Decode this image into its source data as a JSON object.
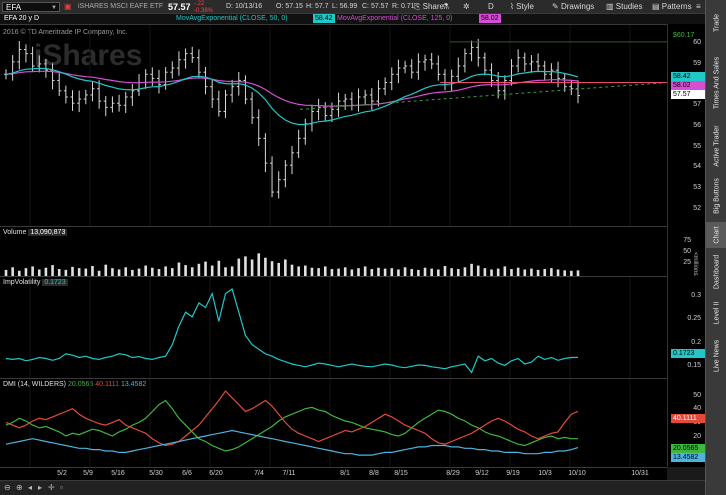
{
  "toolbar": {
    "symbol": "EFA",
    "company": "iSHARES MSCI EAFE ETF",
    "last": "57.57",
    "change": "-.22",
    "change_pct": "-0.38%",
    "d_label": "D: 10/13/16",
    "o_label": "O: 57.15",
    "h_label": "H: 57.7",
    "l_label": "L: 56.99",
    "c_label": "C: 57.57",
    "r_label": "R: 0.71",
    "share": "Share",
    "aggregation": "D",
    "style": "Style",
    "drawings": "Drawings",
    "studies": "Studies",
    "patterns": "Patterns"
  },
  "header2": {
    "chart_label": "EFA 20 y D",
    "study1": "MovAvgExponential (CLOSE, 50, 0)",
    "study1_value": "58.42",
    "study2": "MovAvgExponential (CLOSE, 125, 0)",
    "study2_value": "58.02"
  },
  "price_pane": {
    "copyright": "2016 © TD Ameritrade IP Company, Inc.",
    "watermark": "iShares",
    "high_tag": "$60.17",
    "axis_labels": [
      "60",
      "59",
      "58",
      "57",
      "56",
      "55",
      "54",
      "53",
      "52"
    ],
    "tag_ema50": "58.42",
    "tag_ema125": "58.02",
    "tag_last": "57.57"
  },
  "volume_pane": {
    "title": "Volume",
    "value": "13,090,873",
    "axis_labels": [
      "75",
      "50",
      "25"
    ],
    "unit": "<millions>"
  },
  "iv_pane": {
    "title": "ImpVolatility",
    "value": "0.1723",
    "axis_labels": [
      "0.3",
      "0.25",
      "0.2",
      "0.15"
    ],
    "tag": "0.1723"
  },
  "dmi_pane": {
    "title": "DMI (14, WILDERS)",
    "v1": "20.0565",
    "v2": "40.1111",
    "v3": "13.4582",
    "axis_labels": [
      "50",
      "40",
      "30",
      "20",
      "10"
    ],
    "tag_red": "40.1111",
    "tag_green": "20.0565",
    "tag_blue": "13.4582"
  },
  "x_axis": [
    "5/2",
    "5/9",
    "5/16",
    "5/30",
    "6/6",
    "6/20",
    "7/4",
    "7/11",
    "8/1",
    "8/8",
    "8/15",
    "8/29",
    "9/12",
    "9/19",
    "10/3",
    "10/10",
    "10/31"
  ],
  "right_tabs": [
    "Trade",
    "Times And Sales",
    "Active Trader",
    "Big Buttons",
    "Chart",
    "Dashboard",
    "Level II",
    "Live News"
  ],
  "colors": {
    "up": "#ffffff",
    "down": "#ffffff",
    "ema50": "#22c7c7",
    "ema125": "#d44fd4",
    "trend": "#3d9b3d",
    "resistance": "#e84c6a",
    "iv": "#1fc7c7",
    "dmi_plus": "#3fb63f",
    "dmi_minus": "#e24b3b",
    "adx": "#4fb3e0",
    "negative": "#ff4040"
  },
  "chart_data": [
    {
      "type": "candlestick",
      "series": [
        {
          "name": "MovAvgExponential (CLOSE, 50, 0)",
          "last": 58.42
        },
        {
          "name": "MovAvgExponential (CLOSE, 125, 0)",
          "last": 58.02
        }
      ],
      "ylim": [
        51.5,
        60.5
      ],
      "closes": [
        58.6,
        59.2,
        59.8,
        59.6,
        59.0,
        59.1,
        58.8,
        58.3,
        57.8,
        57.5,
        57.2,
        57.4,
        57.6,
        57.9,
        57.3,
        57.0,
        57.2,
        57.1,
        57.5,
        57.8,
        58.2,
        58.6,
        58.4,
        58.1,
        58.7,
        58.9,
        59.3,
        59.6,
        59.4,
        58.7,
        58.0,
        57.4,
        56.8,
        57.6,
        58.0,
        58.3,
        57.4,
        56.5,
        55.5,
        54.3,
        52.9,
        53.5,
        54.2,
        54.8,
        55.5,
        56.2,
        56.8,
        57.0,
        56.6,
        56.9,
        57.3,
        57.4,
        57.1,
        57.5,
        57.6,
        57.3,
        57.9,
        58.2,
        58.6,
        58.9,
        59.0,
        58.7,
        59.2,
        59.3,
        59.1,
        58.6,
        58.2,
        58.5,
        59.0,
        59.6,
        59.9,
        59.4,
        58.8,
        58.3,
        57.8,
        58.3,
        59.0,
        59.4,
        59.1,
        59.2,
        59.0,
        58.6,
        58.8,
        58.4,
        58.0,
        57.9,
        57.57
      ],
      "last": 57.57,
      "high_marker": 60.17
    },
    {
      "type": "bar",
      "title": "Volume",
      "ylim": [
        0,
        85
      ],
      "values": [
        14,
        20,
        12,
        18,
        22,
        15,
        19,
        25,
        16,
        14,
        21,
        18,
        17,
        23,
        12,
        26,
        18,
        15,
        20,
        14,
        17,
        24,
        19,
        16,
        22,
        18,
        31,
        25,
        20,
        28,
        33,
        24,
        35,
        20,
        22,
        40,
        45,
        38,
        52,
        42,
        34,
        30,
        38,
        26,
        22,
        24,
        19,
        18,
        22,
        16,
        17,
        20,
        15,
        18,
        22,
        16,
        19,
        17,
        18,
        15,
        20,
        16,
        14,
        19,
        17,
        15,
        23,
        18,
        16,
        20,
        28,
        24,
        18,
        15,
        17,
        22,
        16,
        19,
        15,
        17,
        14,
        16,
        18,
        15,
        13,
        12,
        13
      ]
    },
    {
      "type": "line",
      "title": "ImpVolatility",
      "ylim": [
        0.13,
        0.32
      ],
      "values": [
        0.17,
        0.168,
        0.17,
        0.165,
        0.168,
        0.172,
        0.17,
        0.166,
        0.17,
        0.18,
        0.177,
        0.172,
        0.175,
        0.17,
        0.168,
        0.172,
        0.175,
        0.18,
        0.178,
        0.172,
        0.174,
        0.17,
        0.168,
        0.172,
        0.175,
        0.2,
        0.24,
        0.27,
        0.26,
        0.29,
        0.28,
        0.31,
        0.25,
        0.31,
        0.32,
        0.27,
        0.22,
        0.2,
        0.19,
        0.18,
        0.175,
        0.168,
        0.163,
        0.158,
        0.155,
        0.152,
        0.156,
        0.16,
        0.158,
        0.155,
        0.152,
        0.155,
        0.158,
        0.155,
        0.153,
        0.152,
        0.155,
        0.158,
        0.156,
        0.152,
        0.15,
        0.153,
        0.156,
        0.155,
        0.152,
        0.15,
        0.148,
        0.152,
        0.155,
        0.158,
        0.14,
        0.175,
        0.165,
        0.17,
        0.16,
        0.155,
        0.165,
        0.17,
        0.158,
        0.162,
        0.175,
        0.168,
        0.172,
        0.166,
        0.17,
        0.172,
        0.1723
      ]
    },
    {
      "type": "line",
      "title": "DMI (14, WILDERS)",
      "ylim": [
        0,
        55
      ],
      "series": [
        {
          "name": "DI+",
          "values": [
            30,
            32,
            35,
            33,
            30,
            28,
            29,
            27,
            25,
            22,
            24,
            23,
            25,
            27,
            26,
            24,
            22,
            25,
            27,
            30,
            32,
            35,
            40,
            45,
            48,
            42,
            35,
            30,
            25,
            20,
            18,
            15,
            13,
            11,
            12,
            14,
            17,
            20,
            23,
            26,
            29,
            33,
            36,
            38,
            40,
            42,
            43,
            41,
            40,
            37,
            35,
            33,
            32,
            30,
            28,
            27,
            26,
            25,
            23,
            22,
            24,
            28,
            32,
            35,
            38,
            41,
            40,
            38,
            35,
            33,
            30,
            28,
            25,
            23,
            22,
            20,
            18,
            16,
            15,
            17,
            19,
            21,
            22,
            20,
            21,
            20,
            20.0565
          ]
        },
        {
          "name": "DI-",
          "values": [
            32,
            30,
            28,
            30,
            33,
            35,
            34,
            36,
            38,
            40,
            42,
            38,
            35,
            33,
            31,
            30,
            32,
            34,
            30,
            28,
            26,
            24,
            20,
            17,
            15,
            16,
            18,
            22,
            26,
            30,
            36,
            42,
            48,
            55,
            50,
            45,
            40,
            42,
            45,
            48,
            44,
            38,
            32,
            27,
            24,
            22,
            20,
            18,
            20,
            22,
            24,
            26,
            25,
            27,
            29,
            32,
            35,
            38,
            36,
            33,
            30,
            28,
            26,
            24,
            20,
            17,
            16,
            18,
            20,
            22,
            24,
            27,
            30,
            33,
            35,
            33,
            30,
            27,
            25,
            22,
            20,
            22,
            24,
            25,
            32,
            38,
            40.1111
          ]
        },
        {
          "name": "ADX",
          "values": [
            16,
            17,
            18,
            19,
            20,
            19,
            18,
            17,
            16,
            15,
            14,
            13,
            13,
            12,
            12,
            11,
            11,
            10,
            10,
            11,
            12,
            13,
            14,
            15,
            16,
            17,
            18,
            19,
            20,
            21,
            22,
            23,
            24,
            25,
            26,
            25,
            24,
            23,
            22,
            21,
            20,
            19,
            18,
            17,
            16,
            15,
            14,
            13,
            12,
            11,
            10,
            9,
            9,
            8,
            8,
            8,
            9,
            10,
            10,
            11,
            12,
            13,
            14,
            14,
            15,
            15,
            15,
            14,
            14,
            13,
            13,
            12,
            12,
            11,
            11,
            10,
            10,
            10,
            9,
            9,
            9,
            10,
            10,
            11,
            11,
            12,
            13.4582
          ]
        }
      ]
    }
  ]
}
